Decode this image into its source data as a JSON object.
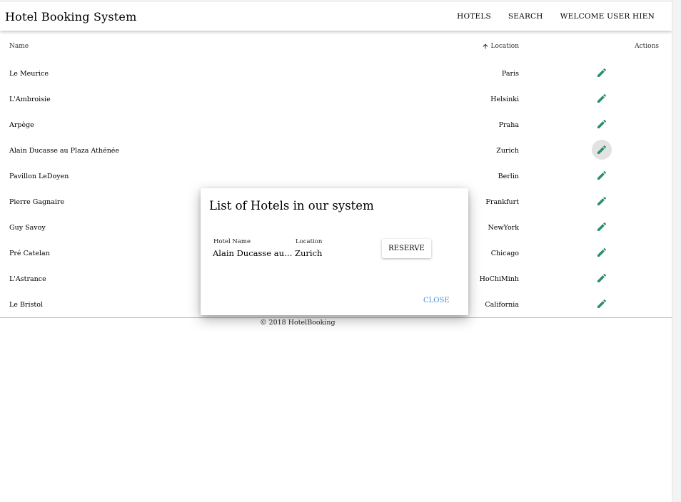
{
  "colors": {
    "accent": "#2a8c72",
    "link": "#4a8fd3"
  },
  "header": {
    "title": "Hotel Booking System",
    "nav": {
      "hotels": "HOTELS",
      "search": "SEARCH",
      "welcome": "WELCOME USER HIEN"
    }
  },
  "table": {
    "columns": {
      "name": "Name",
      "location": "Location",
      "actions": "Actions"
    },
    "sort_icon": "arrow-up-icon",
    "action_icon": "pencil-icon",
    "rows": [
      {
        "name": "Le Meurice",
        "location": "Paris"
      },
      {
        "name": "L'Ambroisie",
        "location": "Helsinki"
      },
      {
        "name": "Arpège",
        "location": "Praha"
      },
      {
        "name": "Alain Ducasse au Plaza Athénée",
        "location": "Zurich"
      },
      {
        "name": "Pavillon LeDoyen",
        "location": "Berlin"
      },
      {
        "name": "Pierre Gagnaire",
        "location": "Frankfurt"
      },
      {
        "name": "Guy Savoy",
        "location": "NewYork"
      },
      {
        "name": "Pré Catelan",
        "location": "Chicago"
      },
      {
        "name": "L'Astrance",
        "location": "HoChiMinh"
      },
      {
        "name": "Le Bristol",
        "location": "California"
      }
    ]
  },
  "footer": {
    "text": "© 2018 HotelBooking"
  },
  "dialog": {
    "title": "List of Hotels in our system",
    "hotel_name_label": "Hotel Name",
    "hotel_name_value": "Alain Ducasse au Pl...",
    "location_label": "Location",
    "location_value": "Zurich",
    "reserve_label": "RESERVE",
    "close_label": "CLOSE"
  }
}
